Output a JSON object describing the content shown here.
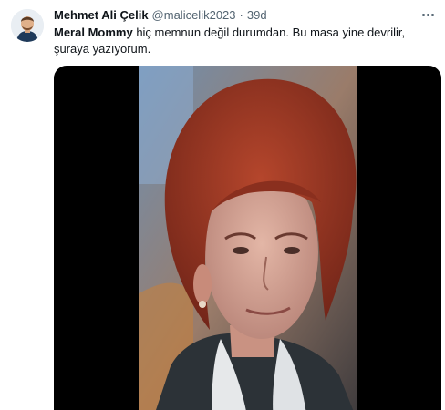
{
  "tweet": {
    "author": {
      "display_name": "Mehmet Ali Çelik",
      "handle": "@malicelik2023",
      "separator": "·",
      "time": "39d",
      "avatar_icon": "avatar-illustration"
    },
    "text": {
      "mention": "Meral Mommy",
      "body": " hiç memnun değil durumdan. Bu masa yine devrilir, şuraya yazıyorum."
    },
    "media": {
      "type": "video-thumbnail"
    },
    "more_icon": "more-options-icon"
  },
  "colors": {
    "text_primary": "#0f1419",
    "text_secondary": "#536471",
    "media_background": "#000000"
  }
}
